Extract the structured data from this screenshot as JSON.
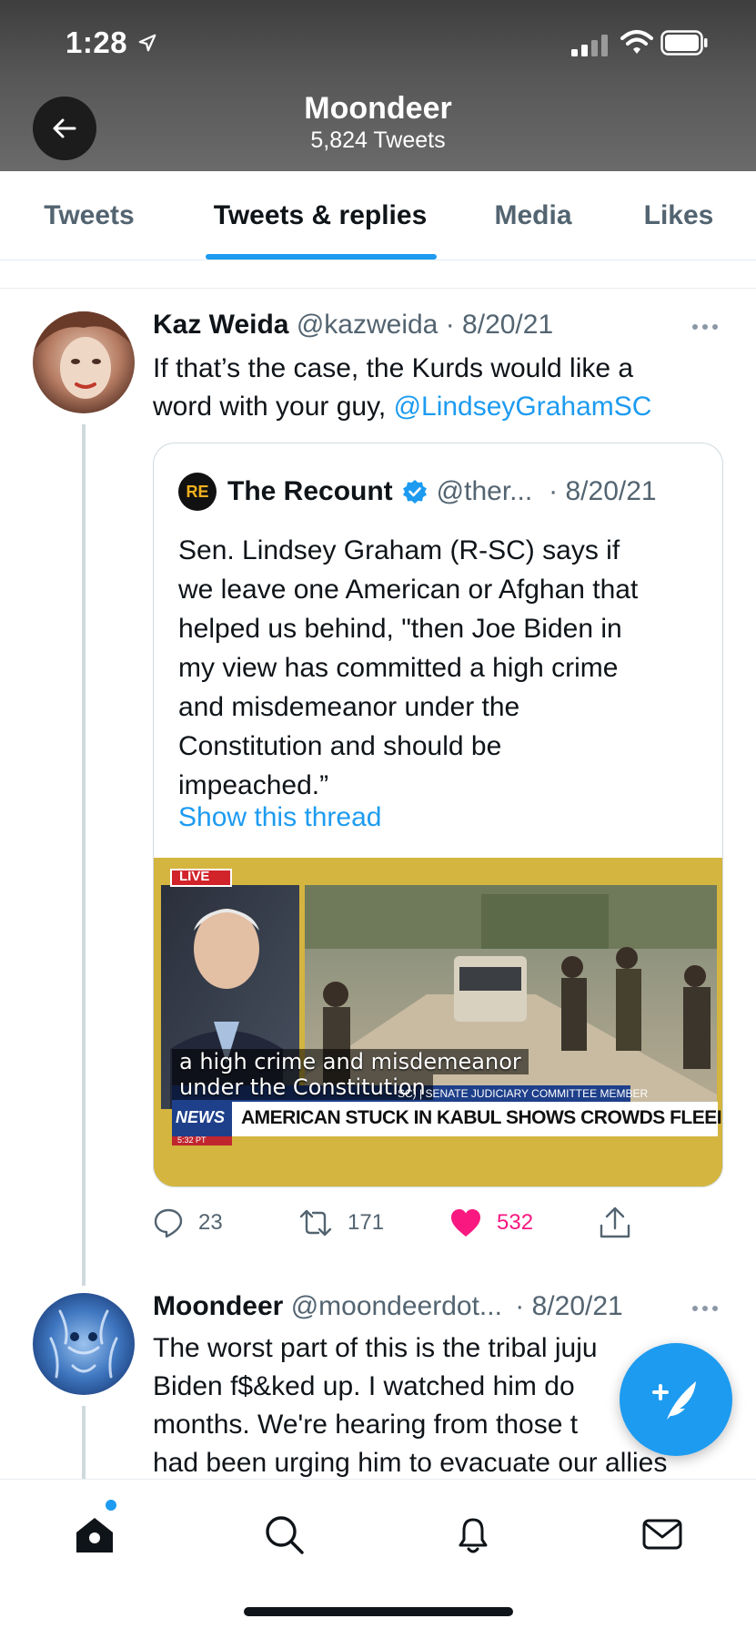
{
  "status_bar": {
    "time": "1:28"
  },
  "header": {
    "title": "Moondeer",
    "subtitle": "5,824 Tweets"
  },
  "tabs": [
    {
      "label": "Tweets",
      "active": false
    },
    {
      "label": "Tweets & replies",
      "active": true
    },
    {
      "label": "Media",
      "active": false
    },
    {
      "label": "Likes",
      "active": false
    }
  ],
  "tweets": [
    {
      "name": "Kaz Weida",
      "handle": "@kazweida",
      "date": "· 8/20/21",
      "text_lines": [
        "If that’s the case, the Kurds would like a",
        "word with your guy, "
      ],
      "mention": "@LindseyGrahamSC",
      "quote": {
        "logo_text": "RE",
        "name": "The Recount",
        "handle": "@ther...",
        "date": "· 8/20/21",
        "text_lines": [
          "Sen. Lindsey Graham (R-SC) says if",
          "we leave one American or Afghan that",
          "helped us behind, \"then Joe Biden in",
          "my view has committed a high crime",
          "and misdemeanor under the",
          "Constitution and should be",
          "impeached.”"
        ],
        "show_thread": "Show this thread",
        "video": {
          "live_label": "LIVE",
          "caption_lines": [
            "a high crime and misdemeanor",
            "under the Constitution"
          ],
          "lower_third_small": "SC) | SENATE JUDICIARY COMMITTEE MEMBER",
          "lower_third_headline": "AMERICAN STUCK IN KABUL SHOWS CROWDS FLEEING",
          "network": "NEWS",
          "clock": "5:32 PT"
        }
      },
      "actions": {
        "replies": "23",
        "retweets": "171",
        "likes": "532"
      }
    },
    {
      "name": "Moondeer",
      "handle": "@moondeerdot...",
      "date": "· 8/20/21",
      "text_lines": [
        "The worst part of this is the tribal juju",
        "Biden f$&ked up. I watched him do",
        "months. We're hearing from those t",
        "had been urging him to evacuate our allies"
      ]
    }
  ],
  "colors": {
    "accent": "#1d9bf0",
    "like": "#f91880",
    "text": "#0f1419",
    "muted": "#536471"
  },
  "icons": [
    "location-arrow-icon",
    "signal-icon",
    "wifi-icon",
    "battery-icon",
    "back-arrow-icon",
    "more-icon",
    "verified-icon",
    "reply-icon",
    "retweet-icon",
    "heart-icon",
    "share-icon",
    "compose-tweet-icon",
    "home-icon",
    "search-icon",
    "bell-icon",
    "mail-icon"
  ]
}
